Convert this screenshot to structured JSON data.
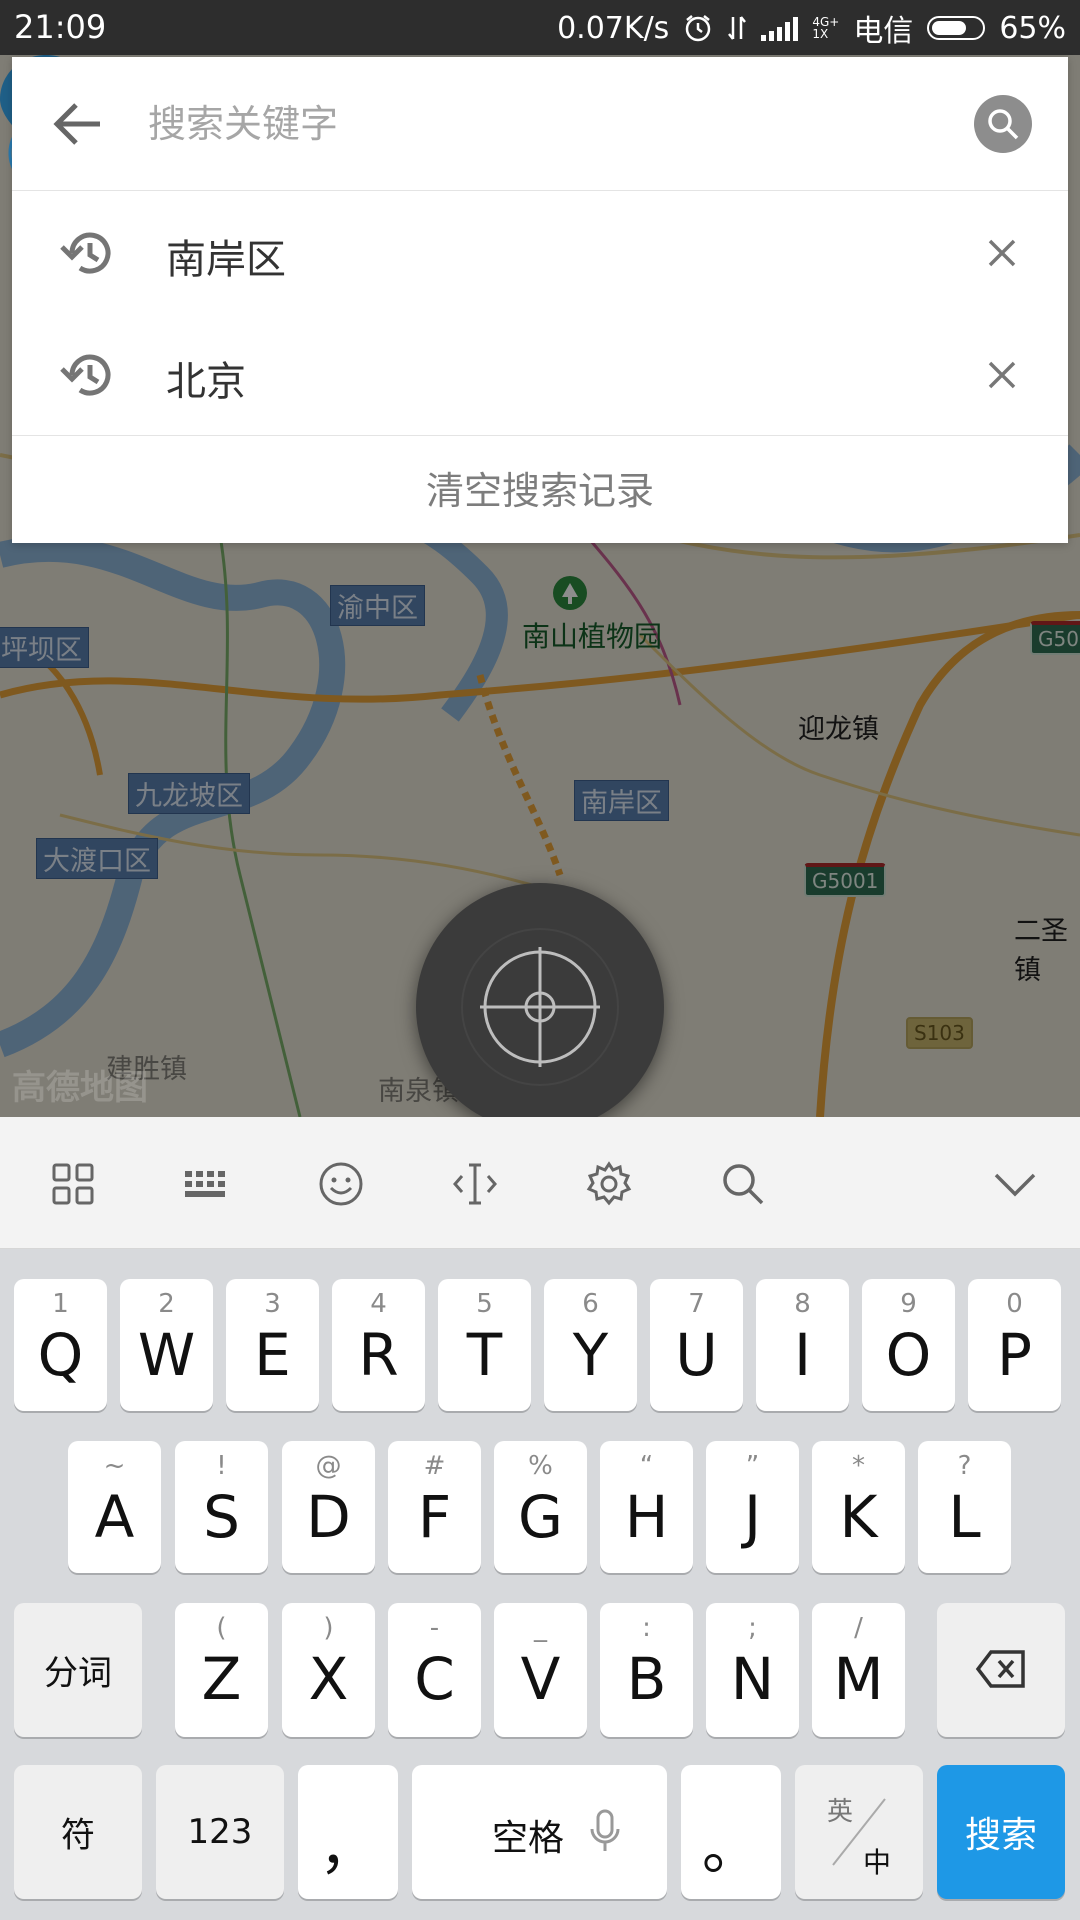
{
  "status_bar": {
    "time": "21:09",
    "speed": "0.07K/s",
    "network_tag_top": "4G+",
    "network_tag_bottom": "1X",
    "carrier": "电信",
    "battery_pct": "65%"
  },
  "search": {
    "placeholder": "搜索关键字",
    "value": ""
  },
  "history": {
    "items": [
      {
        "label": "南岸区"
      },
      {
        "label": "北京"
      }
    ],
    "clear_label": "清空搜索记录"
  },
  "map": {
    "labels": {
      "yuzhong": "渝中区",
      "pingba": "坪坝区",
      "botanical": "南山植物园",
      "yinglong": "迎龙镇",
      "jiulongpo": "九龙坡区",
      "nanan": "南岸区",
      "dadukou": "大渡口区",
      "ersheng": "二圣镇",
      "jiansheng": "建胜镇",
      "nanquan": "南泉镇"
    },
    "shields": {
      "g50": "G50",
      "g5001": "G5001",
      "s103": "S103"
    },
    "watermark": "高德地图"
  },
  "keyboard": {
    "row1": [
      {
        "hint": "1",
        "key": "Q"
      },
      {
        "hint": "2",
        "key": "W"
      },
      {
        "hint": "3",
        "key": "E"
      },
      {
        "hint": "4",
        "key": "R"
      },
      {
        "hint": "5",
        "key": "T"
      },
      {
        "hint": "6",
        "key": "Y"
      },
      {
        "hint": "7",
        "key": "U"
      },
      {
        "hint": "8",
        "key": "I"
      },
      {
        "hint": "9",
        "key": "O"
      },
      {
        "hint": "0",
        "key": "P"
      }
    ],
    "row2": [
      {
        "hint": "~",
        "key": "A"
      },
      {
        "hint": "!",
        "key": "S"
      },
      {
        "hint": "@",
        "key": "D"
      },
      {
        "hint": "#",
        "key": "F"
      },
      {
        "hint": "%",
        "key": "G"
      },
      {
        "hint": "“",
        "key": "H"
      },
      {
        "hint": "”",
        "key": "J"
      },
      {
        "hint": "*",
        "key": "K"
      },
      {
        "hint": "?",
        "key": "L"
      }
    ],
    "row3": [
      {
        "hint": "(",
        "key": "Z"
      },
      {
        "hint": ")",
        "key": "X"
      },
      {
        "hint": "-",
        "key": "C"
      },
      {
        "hint": "_",
        "key": "V"
      },
      {
        "hint": ":",
        "key": "B"
      },
      {
        "hint": ";",
        "key": "N"
      },
      {
        "hint": "/",
        "key": "M"
      }
    ],
    "fenci": "分词",
    "fu": "符",
    "num": "123",
    "comma": "，",
    "space": "空格",
    "period": "。",
    "lang_en": "英",
    "lang_zh": "中",
    "enter": "搜索"
  },
  "colors": {
    "accent_blue": "#1e98e6",
    "pin_blue": "#1f79a8"
  }
}
